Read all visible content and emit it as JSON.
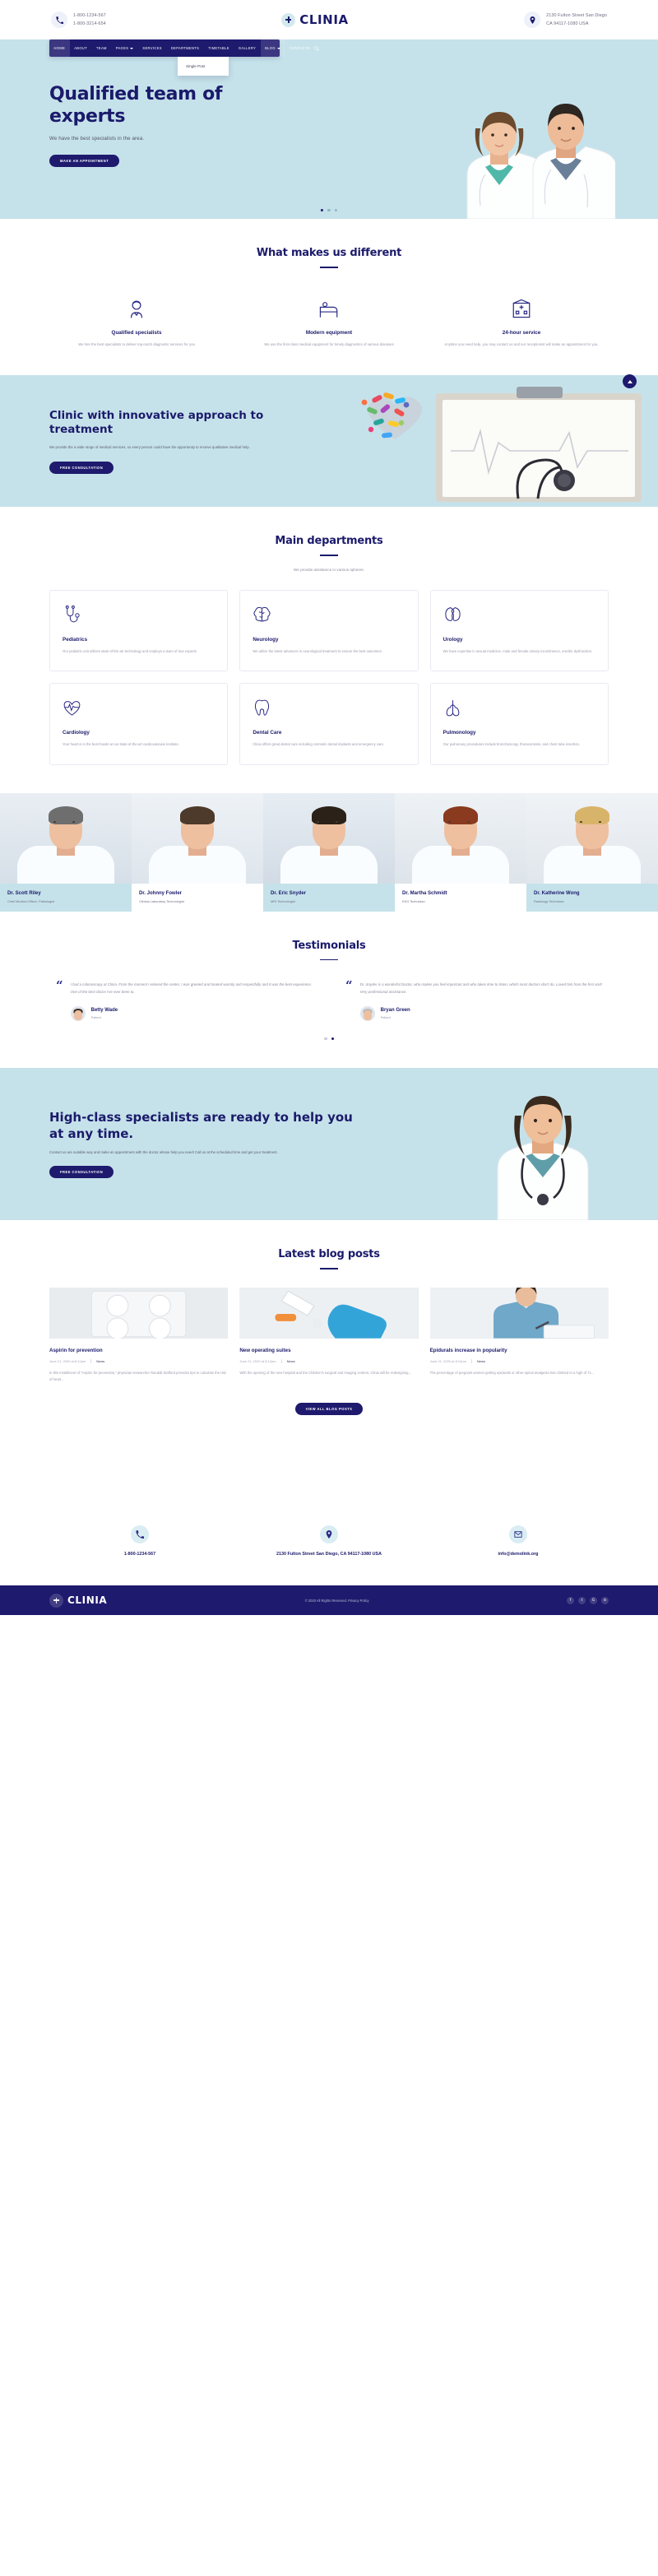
{
  "topbar": {
    "phone_icon": "phone-icon",
    "phones": [
      "1-800-1234-567",
      "1-800-3214-654"
    ],
    "brand": "CLINIA",
    "location_icon": "map-pin-icon",
    "address": [
      "2130 Fulton Street San Diego",
      "CA 94117-1080 USA"
    ]
  },
  "nav": {
    "items": [
      {
        "label": "HOME",
        "active": true,
        "caret": false
      },
      {
        "label": "ABOUT",
        "active": false,
        "caret": false
      },
      {
        "label": "TEAM",
        "active": false,
        "caret": false
      },
      {
        "label": "PAGES",
        "active": false,
        "caret": true
      },
      {
        "label": "SERVICES",
        "active": false,
        "caret": false
      },
      {
        "label": "DEPARTMENTS",
        "active": false,
        "caret": false
      },
      {
        "label": "TIMETABLE",
        "active": false,
        "caret": false
      },
      {
        "label": "GALLERY",
        "active": false,
        "caret": false
      },
      {
        "label": "BLOG",
        "active": true,
        "caret": true
      },
      {
        "label": "CONTACTS",
        "active": false,
        "caret": false
      }
    ],
    "search_icon": "search-icon",
    "dropdown": {
      "open_for": "BLOG",
      "items": [
        "Single Post"
      ]
    }
  },
  "hero": {
    "title": "Qualified team of experts",
    "subtitle": "We have the best specialists in the area.",
    "cta": "MAKE AN APPOINTMENT",
    "slides": 3,
    "active_slide": 1
  },
  "features": {
    "title": "What makes us different",
    "items": [
      {
        "icon": "doctor-avatar-icon",
        "title": "Qualified specialists",
        "text": "We hire the best specialists to deliver top-notch diagnostic services for you"
      },
      {
        "icon": "hospital-bed-icon",
        "title": "Modern equipment",
        "text": "We use the first-class medical equipment for timely diagnostics of various diseases"
      },
      {
        "icon": "hospital-building-icon",
        "title": "24-hour service",
        "text": "Anytime you need help, you may contact us and our receptionist will make an appointment for you."
      }
    ],
    "scroll_top_icon": "chevron-up-icon"
  },
  "banner": {
    "title": "Clinic with innovative approach to treatment",
    "text": "We provide the a wide range of medical services, so every person could have the opportunity to receive qualitative medical help.",
    "cta": "FREE CONSULTATION"
  },
  "departments": {
    "title": "Main departments",
    "subtitle": "We provide assistance in various spheres.",
    "cards": [
      {
        "icon": "stethoscope-icon",
        "title": "Pediatrics",
        "text": "Our pediatric unit utilizes state-of-the-art technology and employs a team of true experts."
      },
      {
        "icon": "brain-icon",
        "title": "Neurology",
        "text": "We utilize the latest advances in neurological treatment to ensure the best outcomes."
      },
      {
        "icon": "kidney-icon",
        "title": "Urology",
        "text": "We have expertise in sexual medicine, male and female urinary incontinence, erectile dysfunction."
      },
      {
        "icon": "heartbeat-icon",
        "title": "Cardiology",
        "text": "Your heart is in the best hands at our state-of-the-art cardiovascular institute."
      },
      {
        "icon": "tooth-icon",
        "title": "Dental Care",
        "text": "Clinia offers great dental care including cosmetic dental implants and emergency care."
      },
      {
        "icon": "lungs-icon",
        "title": "Pulmonology",
        "text": "Our pulmonary procedures include bronchoscopy, thoracentesis, and chest tube insertion."
      }
    ]
  },
  "team": [
    {
      "name": "Dr. Scott Riley",
      "role": "Chief Medical Officer, Pathologist"
    },
    {
      "name": "Dr. Johnny Fowler",
      "role": "Clinical Laboratory Technologist"
    },
    {
      "name": "Dr. Eric Snyder",
      "role": "MRI Technologist"
    },
    {
      "name": "Dr. Martha Schmidt",
      "role": "EKG Technician"
    },
    {
      "name": "Dr. Katherine Wong",
      "role": "Radiology Technician"
    }
  ],
  "testimonials": {
    "title": "Testimonials",
    "items": [
      {
        "text": "I had a colonoscopy at Clinia. From the moment I entered the center, I was greeted and treated warmly and respectfully and it was the best experience. One of the best clinics I've ever been to.",
        "name": "Betty Wade",
        "role": "Patient"
      },
      {
        "text": "Dr. Snyder is a wonderful Doctor, who makes you feel important and who takes time to listen, which most doctors don't do. Loved him from the first visit! Very professional assistance.",
        "name": "Bryan Green",
        "role": "Patient"
      }
    ],
    "slides": 2,
    "active_slide": 1
  },
  "cta": {
    "title": "High-class specialists are ready to help you at any time.",
    "text": "Contact us are suitable way and make an appointment with the doctor whose help you need! Call us at the scheduled time and get your treatment.",
    "button": "FREE CONSULTATION"
  },
  "blog": {
    "title": "Latest blog posts",
    "posts": [
      {
        "thumb": "pill-blister-pack-photo",
        "title": "Aspirin for prevention",
        "date": "June 21, 2020 at 8:12pm",
        "category": "News",
        "excerpt": "In this installment of \"Aspirin for prevention,\" physician-researcher Randall Stafford provides tips to calculate the risk of heart..."
      },
      {
        "thumb": "surgical-gloves-photo",
        "title": "New operating suites",
        "date": "June 21, 2020 at 8:12pm",
        "category": "News",
        "excerpt": "With the opening of the new hospital and the Children's surgical and imaging centers, Clinia will be redesigning..."
      },
      {
        "thumb": "doctor-writing-photo",
        "title": "Epidurals increase in popularity",
        "date": "June 21, 2020 at 8:12pm",
        "category": "News",
        "excerpt": "The percentage of pregnant women getting epidurals or other spinal analgesia has climbed to a high of 71..."
      }
    ],
    "view_all": "VIEW ALL BLOG POSTS"
  },
  "contacts": [
    {
      "icon": "phone-icon",
      "text": "1-800-1234-567"
    },
    {
      "icon": "map-pin-icon",
      "text": "2130 Fulton Street San Diego, CA 94117-1080 USA"
    },
    {
      "icon": "envelope-icon",
      "text": "info@demolink.org"
    }
  ],
  "footer": {
    "brand": "CLINIA",
    "copyright": "© 2020 All Rights Reserved. Privacy Policy",
    "socials": [
      "f",
      "t",
      "G",
      "in"
    ]
  },
  "colors": {
    "navy": "#1e1a6e",
    "light_blue": "#c5e2ea",
    "accent": "#2a2a86",
    "muted": "#9a9aae"
  }
}
